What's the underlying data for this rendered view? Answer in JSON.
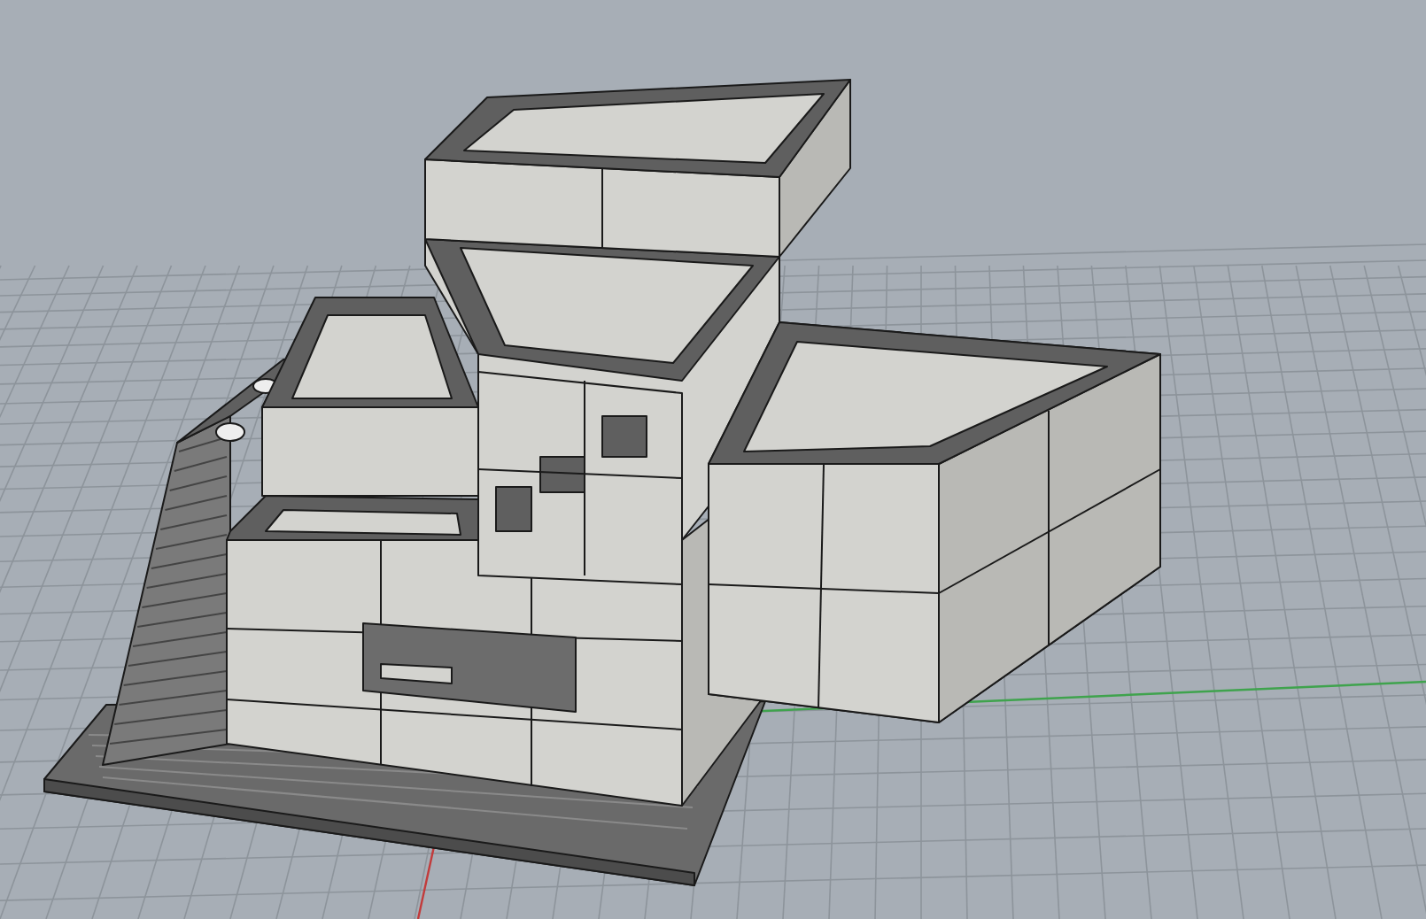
{
  "viewport": {
    "kind": "perspective",
    "grid": true
  }
}
